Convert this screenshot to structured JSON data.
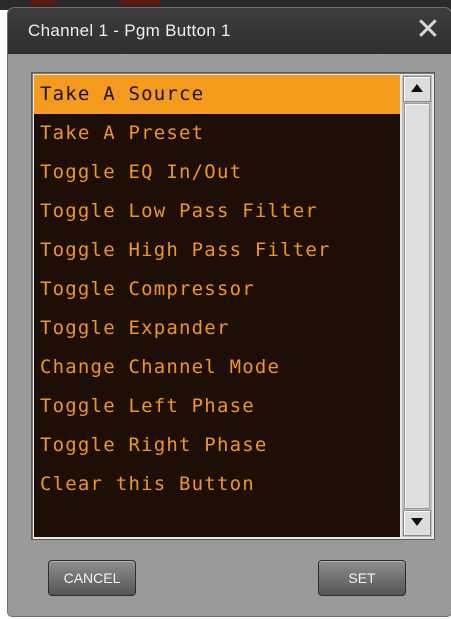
{
  "dialog": {
    "title": "Channel 1 - Pgm Button 1",
    "close_glyph": "✕"
  },
  "list": {
    "selected_index": 0,
    "items": [
      "Take A Source",
      "Take A Preset",
      "Toggle EQ In/Out",
      "Toggle Low Pass Filter",
      "Toggle High Pass Filter",
      "Toggle Compressor",
      "Toggle Expander",
      "Change Channel Mode",
      "Toggle Left Phase",
      "Toggle Right Phase",
      "Clear this Button"
    ]
  },
  "buttons": {
    "cancel_label": "CANCEL",
    "set_label": "SET"
  },
  "colors": {
    "list_background": "#1e0f06",
    "list_text": "#f29421",
    "selected_background": "#f49a1c",
    "titlebar": "#333333",
    "dialog_body": "#9a9a9a"
  }
}
